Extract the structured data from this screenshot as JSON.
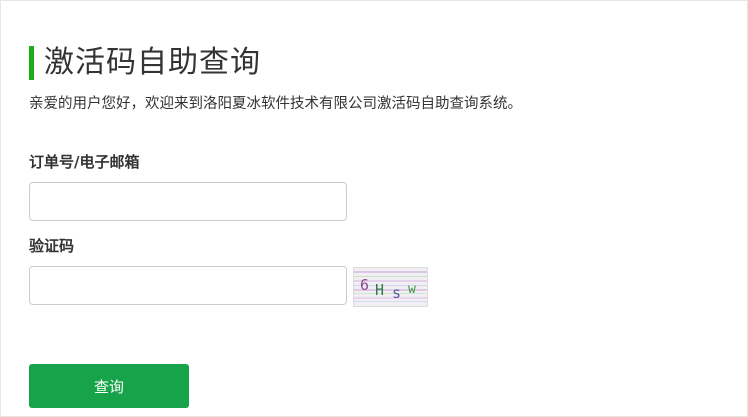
{
  "page": {
    "title": "激活码自助查询",
    "subtitle": "亲爱的用户您好，欢迎来到洛阳夏冰软件技术有限公司激活码自助查询系统。"
  },
  "form": {
    "order_label": "订单号/电子邮箱",
    "order_value": "",
    "captcha_label": "验证码",
    "captcha_value": "",
    "captcha_text": "6Hsw",
    "submit_label": "查询"
  },
  "colors": {
    "accent": "#1aad19",
    "button": "#17a34a"
  }
}
